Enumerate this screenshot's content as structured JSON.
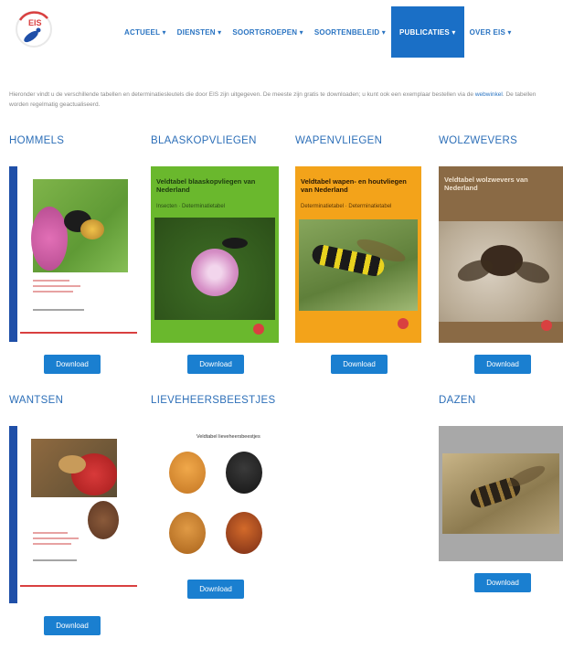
{
  "nav": {
    "items": [
      "ACTUEEL ▾",
      "DIENSTEN ▾",
      "SOORTGROEPEN ▾",
      "SOORTENBELEID ▾",
      "PUBLICATIES ▾",
      "OVER EIS ▾"
    ],
    "active_index": 4
  },
  "intro": {
    "text": "Hieronder vindt u de verschillende tabellen en determinatiesleutels die door EIS zijn uitgegeven. De meeste zijn gratis te downloaden; u kunt ook een exemplaar bestellen via de ",
    "link": "webwinkel",
    "text_after": ". De tabellen worden regelmatig geactualiseerd."
  },
  "categories": {
    "hommels": "HOMMELS",
    "blaaskopvliegen": "BLAASKOPVLIEGEN",
    "wapenvliegen": "WAPENVLIEGEN",
    "wolzwevers": "WOLZWEVERS",
    "wantsen": "WANTSEN",
    "lieveheersbeestjes": "LIEVEHEERSBEESTJES",
    "dazen": "DAZEN"
  },
  "covers": {
    "blaaskopvliegen_title": "Veldtabel blaaskopvliegen van Nederland",
    "blaaskopvliegen_sub": "Insecten · Determinatietabel",
    "wapenvliegen_title": "Veldtabel wapen- en houtvliegen van Nederland",
    "wapenvliegen_sub": "Determinatietabel · Determinatietabel",
    "wolzwevers_title": "Veldtabel wolzwevers van Nederland",
    "lieveheersbeestjes_title": "Veldtabel lieveheersbeestjes"
  },
  "download_label": "Download",
  "colors": {
    "nav_text": "#2a74c2",
    "nav_active_bg": "#1a6fc6",
    "category_title": "#2d6fb8",
    "button_bg": "#1a7fd0",
    "spine_blue": "#1f4fa8",
    "accent_red": "#d94040",
    "wapen_orange": "#f3a31a",
    "blaaskop_green": "#6ab82d",
    "wolzwever_brown": "#8a6a45"
  }
}
